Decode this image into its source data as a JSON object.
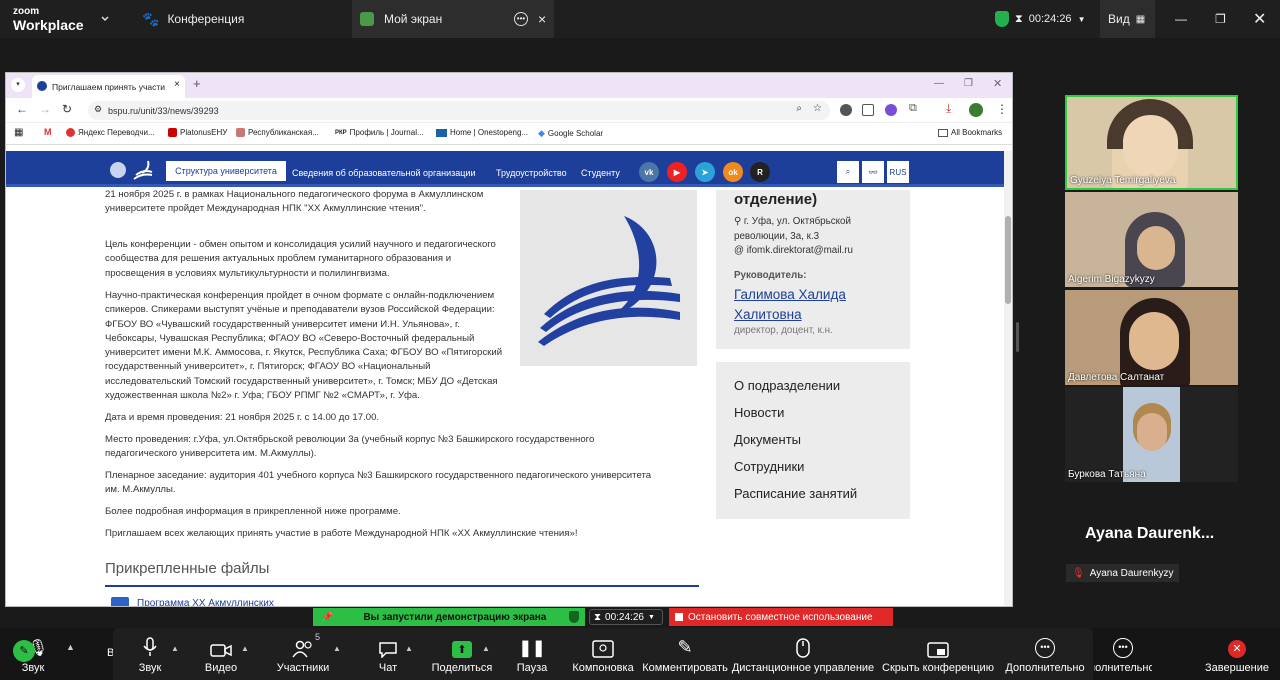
{
  "zoom": {
    "brand_top": "zoom",
    "brand_bottom": "Workplace",
    "tab_conference": "Конференция",
    "tab_my_screen": "Мой экран",
    "timer": "00:24:26",
    "view_label": "Вид"
  },
  "browser": {
    "tab_title": "Приглашаем принять участи",
    "url": "bspu.ru/unit/33/news/39293",
    "bookmarks": [
      "Яндекс Переводчи...",
      "PlatonusЕНУ",
      "Республиканская...",
      "Профиль | Journal...",
      "Home | Onestopeng...",
      "Google Scholar"
    ],
    "all_bookmarks": "All Bookmarks"
  },
  "site": {
    "nav_active": "Структура университета",
    "nav_links": [
      "Сведения об образовательной организации",
      "Трудоустройство",
      "Студенту"
    ],
    "lang": "RUS",
    "paragraphs": [
      "21 ноября 2025 г. в рамках Национального педагогического форума в Акмуллинском университете пройдет Международная НПК \"XX Акмуллинские чтения\".",
      "Цель конференции - обмен опытом и консолидация усилий научного и педагогического сообщества для решения актуальных проблем гуманитарного образования и просвещения в условиях мультикультурности и полилингвизма.",
      "Научно-практическая конференция пройдет в очном формате с онлайн-подключением спикеров. Спикерами выступят учёные и преподаватели вузов Российской Федерации: ФГБОУ ВО «Чувашский государственный университет имени И.Н. Ульянова», г. Чебоксары, Чувашская Республика; ФГАОУ ВО «Северо-Восточный федеральный университет имени М.К. Аммосова, г. Якутск, Республика Саха; ФГБОУ ВО «Пятигорский государственный университет», г. Пятигорск;  ФГАОУ ВО «Национальный исследовательский Томский государственный университет», г. Томск;  МБУ ДО «Детская художественная школа №2» г. Уфа; ГБОУ РПМГ №2 «СМАРТ», г. Уфа.",
      "Дата и время проведения: 21 ноября 2025 г. с 14.00 до 17.00.",
      "Место проведения: г.Уфа, ул.Октябрьской революции 3а (учебный корпус №3 Башкирского государственного педагогического университета им. М.Акмуллы).",
      "Пленарное заседание: аудитория 401 учебного корпуса №3 Башкирского государственного педагогического университета им. М.Акмуллы.",
      "Более подробная информация в прикрепленной ниже программе.",
      "Приглашаем всех желающих принять участие в работе Международной НПК «XX Акмуллинские чтения»!"
    ],
    "files_heading": "Прикрепленные файлы",
    "file_link": "Программа XX Акмуллинских",
    "side_title": "отделение)",
    "side_address": "г. Уфа, ул. Октябрьской революции, 3а, к.3",
    "side_email": "ifomk.direktorat@mail.ru",
    "side_head_label": "Руководитель:",
    "side_head_name": "Галимова Халида Халитовна",
    "side_head_role": "директор, доцент, к.н.",
    "menu": [
      "О подразделении",
      "Новости",
      "Документы",
      "Сотрудники",
      "Расписание занятий"
    ]
  },
  "participants": [
    {
      "name": "Gyuzelya Temirgaliyeva"
    },
    {
      "name": "Aigerim Bigazykyzy"
    },
    {
      "name": "Давлетова Салтанат"
    },
    {
      "name": "Буркова Татьяна"
    }
  ],
  "speaker_name": "Ayana Daurenk...",
  "speaker_label": "Ayana Daurenkyzy",
  "share_banner": {
    "message": "Вы запустили демонстрацию экрана",
    "timer": "00:24:26",
    "stop": "Остановить совместное использование"
  },
  "toolbar": {
    "left_audio": "Звук",
    "participants_count": "5",
    "items": [
      "Звук",
      "Видео",
      "Участники",
      "Чат",
      "Поделиться",
      "Пауза",
      "Компоновка",
      "Комментировать",
      "Дистанционное управление",
      "Скрыть конференцию",
      "Дополнительно"
    ],
    "more_bg": "Дополнительно",
    "end": "Завершение"
  },
  "colors": {
    "site_blue": "#1d3f9a",
    "zoom_green": "#00b140",
    "stop_red": "#e02828"
  }
}
